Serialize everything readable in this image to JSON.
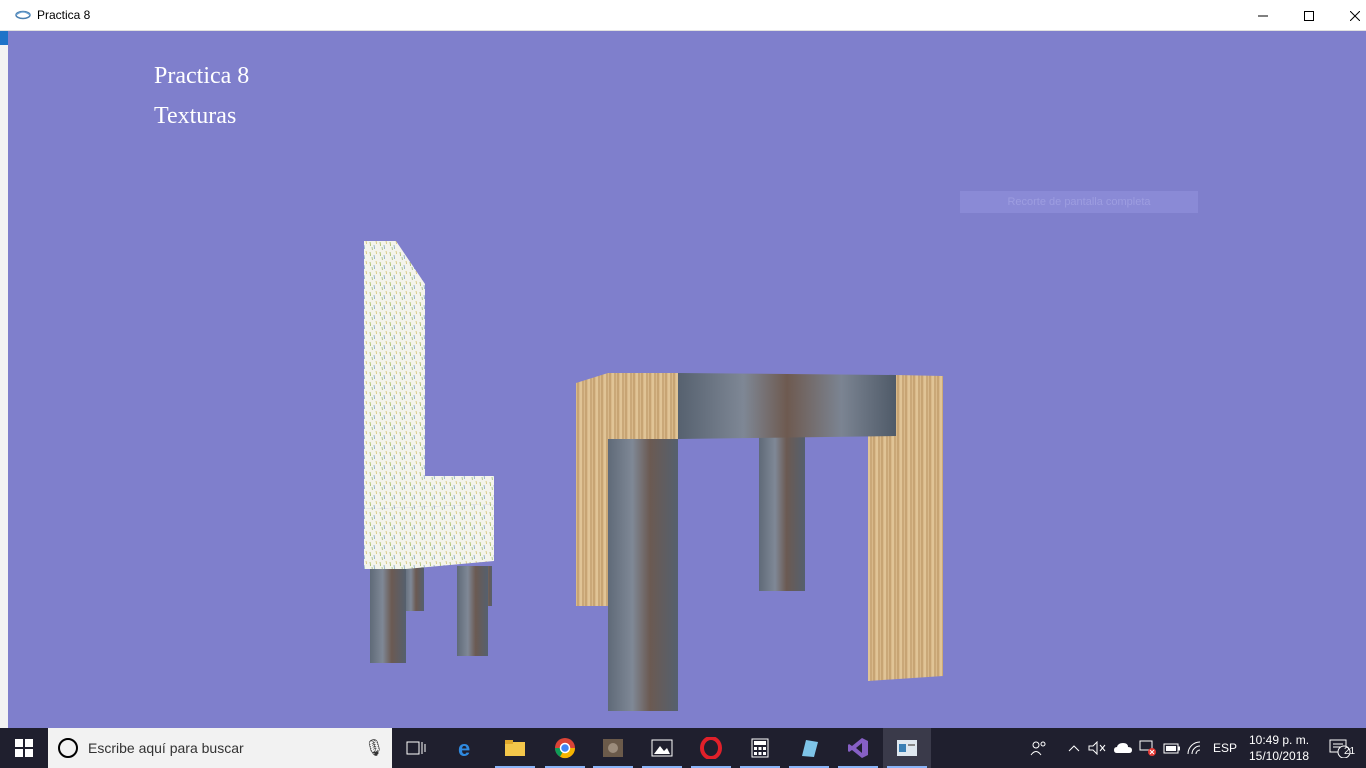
{
  "window": {
    "title": "Practica 8",
    "controls": {
      "minimize": "—",
      "maximize": "☐",
      "close": "✕"
    }
  },
  "viewport": {
    "background_color": "#7f7fcc",
    "overlay_title": "Practica 8",
    "overlay_subtitle": "Texturas",
    "snip_banner": "Recorte de pantalla completa"
  },
  "taskbar": {
    "search_placeholder": "Escribe aquí para buscar",
    "apps": [
      {
        "name": "task-view-icon"
      },
      {
        "name": "edge-icon"
      },
      {
        "name": "file-explorer-icon"
      },
      {
        "name": "chrome-icon"
      },
      {
        "name": "gimp-icon"
      },
      {
        "name": "photos-icon"
      },
      {
        "name": "opera-icon"
      },
      {
        "name": "calculator-icon"
      },
      {
        "name": "app-icon"
      },
      {
        "name": "visual-studio-icon"
      },
      {
        "name": "practica-window-icon"
      }
    ],
    "tray": {
      "language": "ESP",
      "time": "10:49 p. m.",
      "date": "15/10/2018",
      "notifications_count": "21"
    }
  }
}
